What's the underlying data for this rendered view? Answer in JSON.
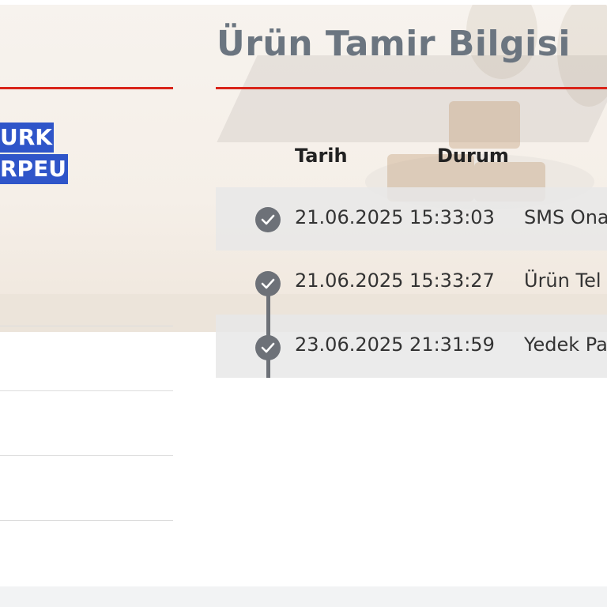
{
  "left_panel": {
    "selected_lines": [
      "URK",
      "RPEU"
    ]
  },
  "repair_panel": {
    "title": "Ürün Tamir Bilgisi",
    "columns": [
      "Tarih",
      "Durum"
    ],
    "rows": [
      {
        "date": "21.06.2025 15:33:03",
        "status": "SMS Ona"
      },
      {
        "date": "21.06.2025 15:33:27",
        "status": "Ürün Tel"
      },
      {
        "date": "23.06.2025 21:31:59",
        "status": "Yedek Pa"
      }
    ]
  },
  "icons": {
    "row_status": "check-circle-icon"
  },
  "colors": {
    "accent_rule": "#d9241a",
    "selection": "#2f55c9",
    "icon": "#6d7178",
    "title": "#6b7580"
  }
}
